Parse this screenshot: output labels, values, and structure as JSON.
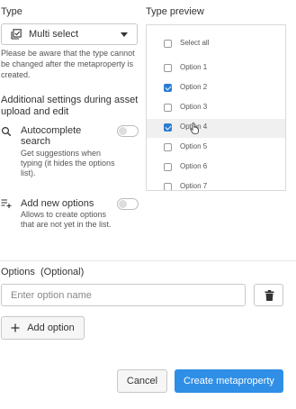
{
  "type_section": {
    "label": "Type",
    "selected": "Multi select",
    "hint": "Please be aware that the type cannot be changed after the metaproperty is created."
  },
  "additional": {
    "heading": "Additional settings during asset upload and edit",
    "autocomplete": {
      "title": "Autocomplete search",
      "desc": "Get suggestions when typing (it hides the options list).",
      "enabled": false
    },
    "add_new": {
      "title": "Add new options",
      "desc": "Allows to create options that are not yet in the list.",
      "enabled": false
    }
  },
  "preview": {
    "label": "Type preview",
    "items": [
      {
        "label": "Select all",
        "checked": false
      },
      {
        "label": "Option 1",
        "checked": false
      },
      {
        "label": "Option 2",
        "checked": true
      },
      {
        "label": "Option 3",
        "checked": false
      },
      {
        "label": "Option 4",
        "checked": true,
        "hover": true
      },
      {
        "label": "Option 5",
        "checked": false
      },
      {
        "label": "Option 6",
        "checked": false
      },
      {
        "label": "Option 7",
        "checked": false
      }
    ]
  },
  "options": {
    "label": "Options",
    "optional": "(Optional)",
    "placeholder": "Enter option name",
    "value": "",
    "add_label": "Add option"
  },
  "footer": {
    "cancel": "Cancel",
    "create": "Create metaproperty"
  },
  "colors": {
    "primary": "#2f8ee6",
    "checkbox": "#2b7cd3"
  }
}
